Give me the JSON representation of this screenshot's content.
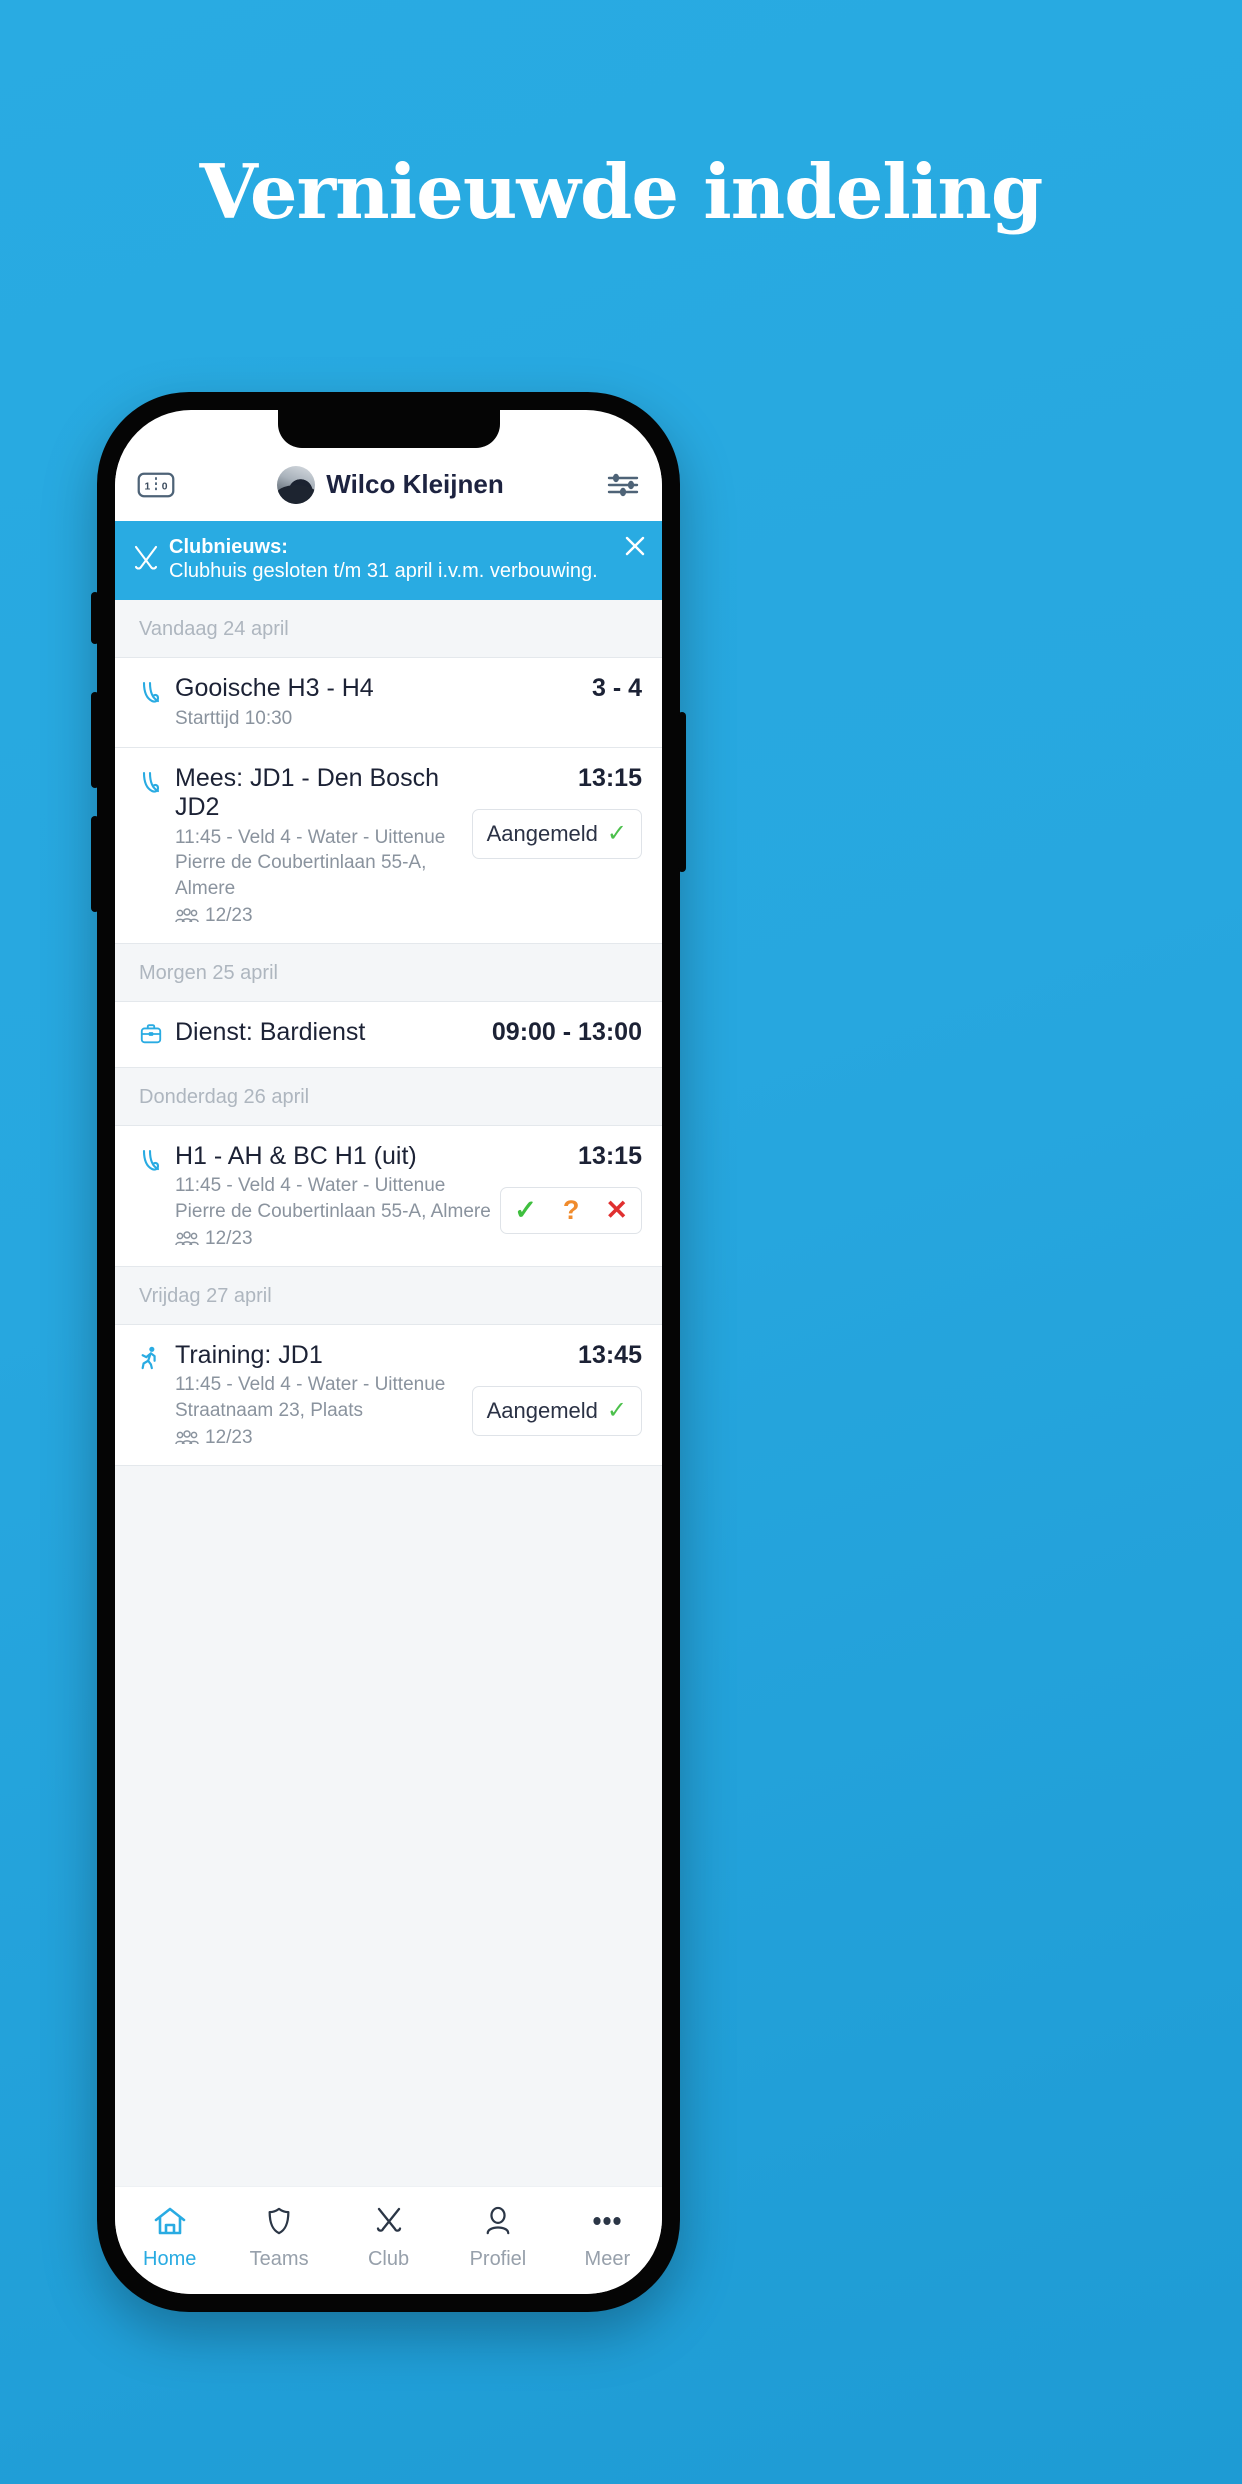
{
  "headline": "Vernieuwde indeling",
  "theme": {
    "background_blue": "#29ABE2",
    "accent_blue": "#29ABE2",
    "text_dark": "#1C2235",
    "text_muted": "#8A939E",
    "green": "#4CC04C",
    "orange": "#F08B2C",
    "red": "#E03030"
  },
  "app": {
    "header": {
      "score_icon": "scoreboard-icon",
      "score_left": "1",
      "score_right": "0",
      "avatar_icon": "user-avatar",
      "user_name": "Wilco Kleijnen",
      "filter_icon": "filter-sliders-icon"
    },
    "banner": {
      "icon": "crossed-hockey-sticks-icon",
      "title": "Clubnieuws:",
      "message": "Clubhuis gesloten t/m 31 april i.v.m. verbouwing.",
      "close_icon": "close-icon"
    },
    "days": [
      {
        "label": "Vandaag 24 april",
        "events": [
          {
            "icon": "hockey-sticks-icon",
            "title": "Gooische H3 - H4",
            "lines": [
              "Starttijd 10:30"
            ],
            "attendance": null,
            "time": "3 - 4",
            "action": null
          },
          {
            "icon": "hockey-sticks-icon",
            "title": "Mees: JD1 - Den Bosch JD2",
            "lines": [
              "11:45 - Veld 4 - Water - Uittenue",
              "Pierre de Coubertinlaan 55-A, Almere"
            ],
            "attendance": "12/23",
            "time": "13:15",
            "action": {
              "type": "pill",
              "label": "Aangemeld",
              "tick": "✓"
            }
          }
        ]
      },
      {
        "label": "Morgen 25 april",
        "events": [
          {
            "icon": "briefcase-icon",
            "title": "Dienst: Bardienst",
            "lines": [],
            "attendance": null,
            "time": "09:00 - 13:00",
            "action": null
          }
        ]
      },
      {
        "label": "Donderdag 26 april",
        "events": [
          {
            "icon": "hockey-sticks-icon",
            "title": "H1 - AH & BC H1 (uit)",
            "lines": [
              "11:45 - Veld 4 - Water - Uittenue",
              "Pierre de Coubertinlaan 55-A, Almere"
            ],
            "attendance": "12/23",
            "time": "13:15",
            "action": {
              "type": "rsvp",
              "yes": "✓",
              "maybe": "?",
              "no": "✕"
            }
          }
        ]
      },
      {
        "label": "Vrijdag 27 april",
        "events": [
          {
            "icon": "running-person-icon",
            "title": "Training: JD1",
            "lines": [
              "11:45 - Veld 4 - Water - Uittenue",
              "Straatnaam 23, Plaats"
            ],
            "attendance": "12/23",
            "time": "13:45",
            "action": {
              "type": "pill",
              "label": "Aangemeld",
              "tick": "✓"
            }
          }
        ]
      }
    ],
    "tabs": [
      {
        "label": "Home",
        "icon": "home-icon",
        "active": true
      },
      {
        "label": "Teams",
        "icon": "shield-icon",
        "active": false
      },
      {
        "label": "Club",
        "icon": "hockey-sticks-icon",
        "active": false
      },
      {
        "label": "Profiel",
        "icon": "person-icon",
        "active": false
      },
      {
        "label": "Meer",
        "icon": "ellipsis-icon",
        "active": false
      }
    ]
  }
}
